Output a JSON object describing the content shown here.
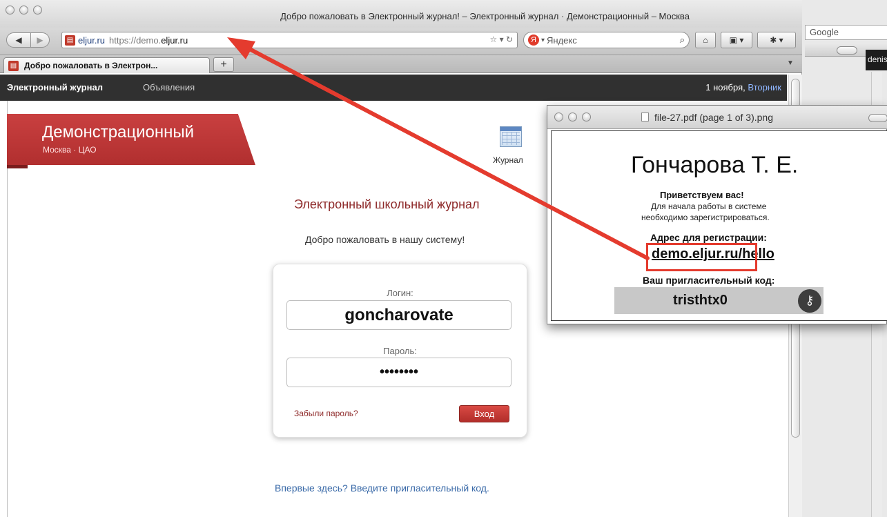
{
  "background": {
    "google_placeholder": "Google",
    "partial_text": "denis"
  },
  "browser": {
    "window_title": "Добро пожаловать в Электронный журнал! – Электронный журнал · Демонстрационный – Москва",
    "url": {
      "site_label": "eljur.ru",
      "scheme": "https://",
      "subdomain": "demo.",
      "host": "eljur.ru"
    },
    "search_engine": "Яндекс",
    "tab_title": "Добро пожаловать в Электрон...",
    "new_tab_label": "+"
  },
  "site": {
    "nav": {
      "brand": "Электронный журнал",
      "announcements": "Объявления",
      "date": "1 ноября,",
      "day": "Вторник"
    },
    "school": {
      "name": "Демонстрационный",
      "location": "Москва · ЦАО"
    },
    "journal_label": "Журнал",
    "heading": "Электронный школьный журнал",
    "welcome": "Добро пожаловать в нашу систему!",
    "login": {
      "login_label": "Логин:",
      "login_value": "goncharovate",
      "password_label": "Пароль:",
      "password_value": "••••••••",
      "forgot_link": "Забыли пароль?",
      "submit": "Вход"
    },
    "first_time_link": "Впервые здесь? Введите пригласительный код."
  },
  "preview": {
    "title": "file-27.pdf (page 1 of 3).png",
    "name": "Гончарова Т. Е.",
    "greeting": "Приветствуем вас!",
    "text_line1": "Для начала работы в системе",
    "text_line2": "необходимо зарегистрироваться.",
    "address_label": "Адрес для регистрации:",
    "address": "demo.eljur.ru/hello",
    "code_label": "Ваш пригласительный код:",
    "code": "tristhtx0"
  },
  "annotation_color": "#e43b2e",
  "accent_color": "#b52f2f"
}
